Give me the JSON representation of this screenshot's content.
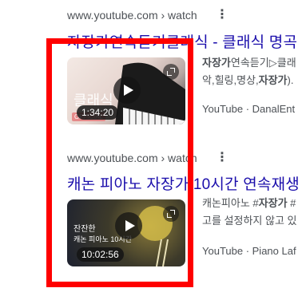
{
  "results": [
    {
      "url": "www.youtube.com › watch",
      "title": "자장가연속듣기클래식 - 클래식 명곡",
      "thumb_overlay_text": "클래식",
      "badge": "OFFICIAL",
      "duration": "1:34:20",
      "snippet_bold": "자장가",
      "snippet_line1_rest": "연속듣기▷클래",
      "snippet_line2_prefix": "악,힐링,명상,",
      "snippet_line2_bold": "자장가",
      "snippet_line2_suffix": ").",
      "source": "YouTube · DanalEnt"
    },
    {
      "url": "www.youtube.com › watch",
      "title": "캐논 피아노 자장가 10시간 연속재생",
      "thumb_overlay_text_1": "잔잔한",
      "thumb_overlay_text_2": "캐논 피아노 10시간",
      "duration": "10:02:56",
      "snippet_prefix": "캐논피아노 #",
      "snippet_bold": "자장가",
      "snippet_suffix": " #",
      "snippet_line2": "고를 설정하지 않고 있",
      "source": "YouTube · Piano Laf"
    }
  ]
}
